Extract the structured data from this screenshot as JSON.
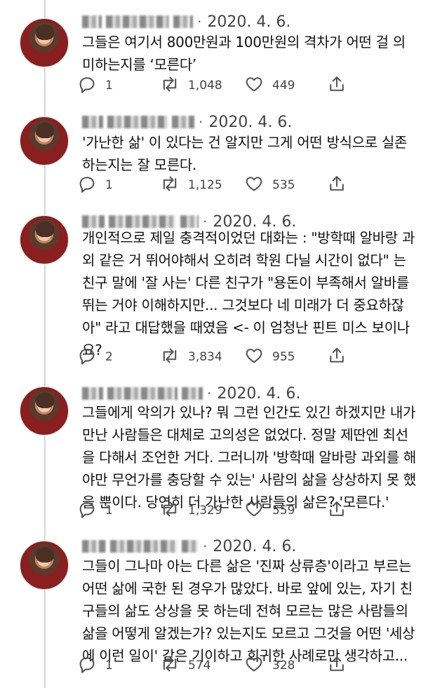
{
  "tweets": [
    {
      "date": "2020. 4. 6.",
      "lines": [
        "그들은 여기서 800만원과 100만원의 격차가 어떤 걸 의",
        "미하는지를 ‘모른다’"
      ],
      "reply_count": "1",
      "retweet_count": "1,048",
      "like_count": "449"
    },
    {
      "date": "2020. 4. 6.",
      "lines": [
        "'가난한 삶' 이 있다는 건 알지만 그게 어떤 방식으로 실존",
        "하는지는 잘 모른다."
      ],
      "reply_count": "1",
      "retweet_count": "1,125",
      "like_count": "535"
    },
    {
      "date": "2020. 4. 6.",
      "lines": [
        "개인적으로 제일 충격적이었던 대화는 : \"방학때 알바랑 과",
        "외 같은 거 뛰어야해서 오히려 학원 다닐 시간이 없다\" 는",
        "친구 말에 '잘 사는' 다른 친구가 \"용돈이 부족해서 알바를",
        "뛰는 거야 이해하지만... 그것보다 네 미래가 더 중요하잖",
        "아\" 라고 대답했을 때였음 <- 이 엄청난 핀트 미스 보이나",
        "요?"
      ],
      "reply_count": "2",
      "retweet_count": "3,834",
      "like_count": "955"
    },
    {
      "date": "2020. 4. 6.",
      "lines": [
        "그들에게 악의가 있나? 뭐 그런 인간도 있긴 하겠지만 내가",
        "만난 사람들은 대체로 고의성은 없었다. 정말 제딴엔 최선",
        "을 다해서 조언한 거다. 그러니까 '방학때 알바랑 과외를 해",
        "야만 무언가를 충당할 수 있는' 사람의 삶을 상상하지 못 했",
        "을 뿐이다. 당연히 더 가난한 사람들의 삶은? '모른다.'"
      ],
      "reply_count": "1",
      "retweet_count": "1,329",
      "like_count": "559"
    },
    {
      "date": "2020. 4. 6.",
      "lines": [
        "그들이 그나마 아는 다른 삶은 '진짜 상류층'이라고 부르는",
        "어떤 삶에 국한 된 경우가 많았다. 바로 앞에 있는, 자기 친",
        "구들의 삶도 상상을 못 하는데 전혀 모르는 많은 사람들의",
        "삶을 어떻게 알겠는가? 있는지도 모르고 그것을 어떤 '세상",
        "에 이런 일이' 같은 기이하고 희귀한 사례로만 생각하고..."
      ],
      "reply_count": "1",
      "retweet_count": "574",
      "like_count": "328"
    }
  ],
  "icons": {
    "reply": "reply-icon",
    "retweet": "retweet-icon",
    "like": "heart-icon",
    "share": "share-icon"
  },
  "colors": {
    "icon": "#555555",
    "thread_line": "#cfd9de",
    "text": "#111111",
    "meta": "#444444"
  }
}
